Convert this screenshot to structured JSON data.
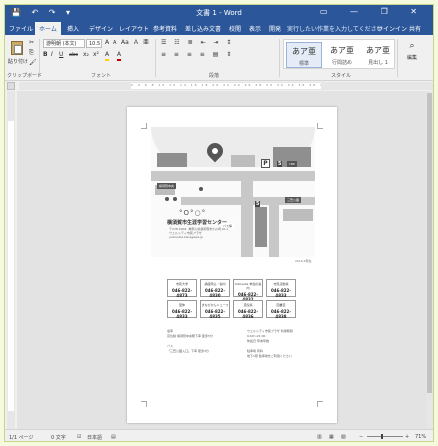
{
  "window": {
    "title": "文書 1 - Word",
    "qat": [
      "💾",
      "↶",
      "↷",
      "▾"
    ],
    "controls": [
      "▭",
      "—",
      "❐",
      "✕"
    ]
  },
  "tabs": [
    "ファイル",
    "ホーム",
    "挿入",
    "デザイン",
    "レイアウト",
    "参考資料",
    "差し込み文書",
    "校閲",
    "表示",
    "開発"
  ],
  "active_tab": "ホーム",
  "tell_me": "実行したい作業を入力してください",
  "sign_in": "サインイン",
  "share": "共有",
  "ribbon": {
    "paste_label": "貼り付け",
    "font_name": "游明朝 (本文)",
    "font_size": "10.5",
    "groups": [
      "クリップボード",
      "フォント",
      "段落",
      "スタイル"
    ],
    "styles": [
      {
        "sample": "あア亜",
        "name": "標準"
      },
      {
        "sample": "あア亜",
        "name": "行間詰め"
      },
      {
        "sample": "あア亜",
        "name": "見出し 1"
      }
    ],
    "edit_label": "編集",
    "row1": [
      "A",
      "A",
      "Aa",
      "Ａ",
      "亜"
    ],
    "row2": [
      "B",
      "I",
      "U",
      "abc",
      "x₂",
      "x²",
      "A",
      "A"
    ]
  },
  "ruler": {
    "ticks": "2 4 6 8 10 12 14 16 18 20 22 24 26 28 30 32 34 36 38 40 42 44 46 48"
  },
  "document": {
    "organization": "横須賀市生涯学習センター",
    "org_address": "〒238-0004  神奈川県横須賀市小川町16-1\nウェルシティ市民プラザ\nyokosuka.kanagawa.jp",
    "map_labels": [
      "YRP",
      "横須賀中央",
      "三笠公園",
      "バス停"
    ],
    "map_caption": "2016.4現在",
    "contacts": [
      {
        "title": "市民大学",
        "phone": "046-822-4873"
      },
      {
        "title": "講座申込・案内",
        "phone": "046-822-4830"
      },
      {
        "title": "Yokosuka 参加の案内",
        "phone": "046-822-4832"
      },
      {
        "title": "市民活動係",
        "phone": "046-822-4833"
      },
      {
        "title": "団体",
        "phone": "046-822-4833"
      },
      {
        "title": "まなびかんニュース",
        "phone": "046-822-4835"
      },
      {
        "title": "貸館係",
        "phone": "046-822-4836"
      },
      {
        "title": "図書室",
        "phone": "046-822-4838"
      }
    ],
    "notes_left": "電車\n京急線 横須賀中央駅下車 徒歩5分\n\nバス\n「三笠公園入口」下車 徒歩3分",
    "notes_right": "ウェルシティ市民プラザ 利用時間\n9:00〜21:00\n休館日 年末年始\n\n駐車場 有料\n地下1階 駐車場をご利用ください"
  },
  "status": {
    "page": "1/1 ページ",
    "words": "0 文字",
    "lang": "日本語",
    "zoom": "71%"
  }
}
